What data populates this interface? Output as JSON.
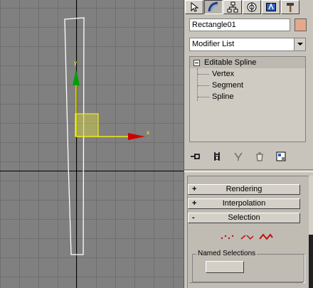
{
  "viewport": {
    "axis_x_label": "x",
    "axis_y_label": "y",
    "colors": {
      "grid_bg": "#808080",
      "grid_line": "#6f6f6f",
      "spline": "#ffffff",
      "axis_x": "#d00000",
      "axis_y": "#00a000",
      "gizmo": "#ffff00",
      "world_axis": "#000000"
    }
  },
  "command_panel": {
    "tabs": [
      {
        "name": "create-tab",
        "icon": "arrow-icon"
      },
      {
        "name": "modify-tab",
        "icon": "bend-icon",
        "active": true
      },
      {
        "name": "hierarchy-tab",
        "icon": "hierarchy-icon"
      },
      {
        "name": "motion-tab",
        "icon": "motion-icon"
      },
      {
        "name": "display-tab",
        "icon": "display-icon"
      },
      {
        "name": "utilities-tab",
        "icon": "hammer-icon"
      }
    ],
    "object_name": "Rectangle01",
    "object_color": "#e7a88a",
    "modifier_list": "Modifier List",
    "modifier_stack": {
      "top": "Editable Spline",
      "children": [
        "Vertex",
        "Segment",
        "Spline"
      ]
    },
    "stack_toolbar": [
      "pin-stack-icon",
      "show-end-result-icon",
      "make-unique-icon",
      "remove-modifier-icon",
      "configure-modifier-sets-icon"
    ],
    "rollouts": [
      {
        "sign": "+",
        "label": "Rendering"
      },
      {
        "sign": "+",
        "label": "Interpolation"
      },
      {
        "sign": "-",
        "label": "Selection"
      }
    ],
    "selection_icons": [
      "vertex-select-icon",
      "segment-select-icon",
      "spline-select-icon"
    ],
    "named_selections_label": "Named Selections"
  }
}
